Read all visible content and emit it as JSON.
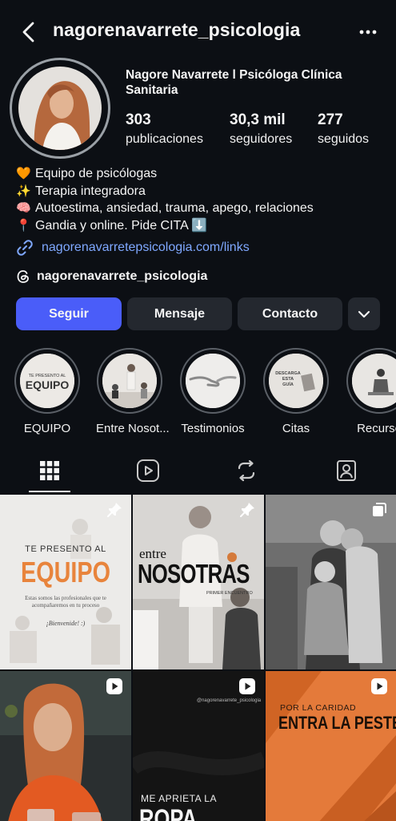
{
  "header": {
    "username": "nagorenavarrete_psicologia",
    "back_icon": "chevron-left-icon",
    "more_icon": "more-horizontal-icon"
  },
  "profile": {
    "full_name": "Nagore Navarrete l Psicóloga Clínica Sanitaria",
    "stats": [
      {
        "value": "303",
        "label": "publicaciones"
      },
      {
        "value": "30,3 mil",
        "label": "seguidores"
      },
      {
        "value": "277",
        "label": "seguidos"
      }
    ],
    "bio": [
      {
        "emoji": "🧡",
        "text": "Equipo de psicólogas"
      },
      {
        "emoji": "✨",
        "text": "Terapia integradora"
      },
      {
        "emoji": "🧠",
        "text": "Autoestima, ansiedad, trauma, apego, relaciones"
      },
      {
        "emoji": "📍",
        "text": "Gandia y online. Pide CITA ⬇️"
      }
    ],
    "link": "nagorenavarretepsicologia.com/links",
    "threads_handle": "nagorenavarrete_psicologia"
  },
  "actions": {
    "follow": "Seguir",
    "message": "Mensaje",
    "contact": "Contacto"
  },
  "highlights": [
    {
      "label": "EQUIPO",
      "cover_text": "TE PRESENTO AL EQUIPO"
    },
    {
      "label": "Entre Nosot...",
      "cover_text": ""
    },
    {
      "label": "Testimonios",
      "cover_text": ""
    },
    {
      "label": "Citas",
      "cover_text": "DESCARGA ESTA GUÍA"
    },
    {
      "label": "Recurso",
      "cover_text": ""
    }
  ],
  "tabs": [
    "grid-icon",
    "reels-icon",
    "reposts-icon",
    "tagged-icon"
  ],
  "posts": [
    {
      "title_small": "TE PRESENTO AL",
      "title_big": "EQUIPO",
      "caption": "Estas somos las profesionales que te acompañaremos en tu proceso",
      "sign": "¡Bienvenide! :)",
      "badge": "pin-icon"
    },
    {
      "title_small": "entre",
      "title_big": "NOSOTRAS",
      "caption": "PRIMER ENCUENTRO",
      "badge": "pin-icon"
    },
    {
      "title_small": "",
      "title_big": "",
      "caption": "",
      "badge": "multi-photo-icon"
    },
    {
      "title_small": "",
      "title_big": "",
      "caption": "",
      "badge": "reel-icon"
    },
    {
      "handle": "@nagorenavarrete_psicologia",
      "title_small": "ME APRIETA LA",
      "title_big": "ROPA",
      "badge": "reel-icon"
    },
    {
      "title_small": "POR LA CARIDAD",
      "title_big": "ENTRA LA PESTE",
      "badge": "reel-icon"
    }
  ],
  "colors": {
    "background": "#0c0f14",
    "follow_button": "#4a5df9",
    "secondary_button": "#24282f",
    "link": "#7fa8ff",
    "equipo_orange": "#e8843c"
  }
}
